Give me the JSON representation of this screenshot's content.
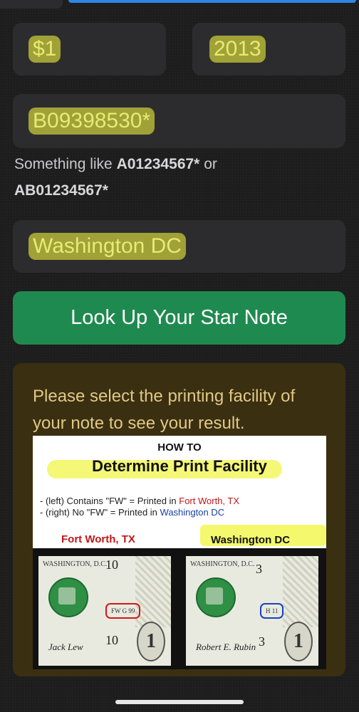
{
  "form": {
    "denomination": "$1",
    "year": "2013",
    "serial": "B09398530*",
    "hint_prefix": "Something like ",
    "hint_example1": "A01234567*",
    "hint_or": " or",
    "hint_example2": "AB01234567*",
    "facility": "Washington DC",
    "lookup_label": "Look Up Your Star Note"
  },
  "result": {
    "message": "Please select the printing facility of your note to see your result.",
    "infographic": {
      "howto": "HOW TO",
      "title": "Determine Print Facility",
      "rule1_prefix": "- (left) Contains \"FW\" = Printed in ",
      "rule1_place": "Fort Worth, TX",
      "rule2_prefix": "- (right) No \"FW\" = Printed in ",
      "rule2_place": "Washington DC",
      "label_left": "Fort Worth, TX",
      "label_right": "Washington DC",
      "bill_left": {
        "city": "WASHINGTON, D.C.",
        "corner": "10",
        "mark": "FW G 99",
        "bottom_num": "10",
        "signature": "Jack Lew",
        "one": "1"
      },
      "bill_right": {
        "city": "WASHINGTON, D.C.",
        "corner": "3",
        "mark": "H 11",
        "bottom_num": "3",
        "signature": "Robert E. Rubin",
        "one": "1"
      }
    }
  },
  "colors": {
    "background": "#1d1d1d",
    "field_bg": "#2c2c2e",
    "field_text": "#e8ea74",
    "button": "#1f8a4f",
    "result_bg": "#3a2f10",
    "result_text": "#e2c887"
  }
}
